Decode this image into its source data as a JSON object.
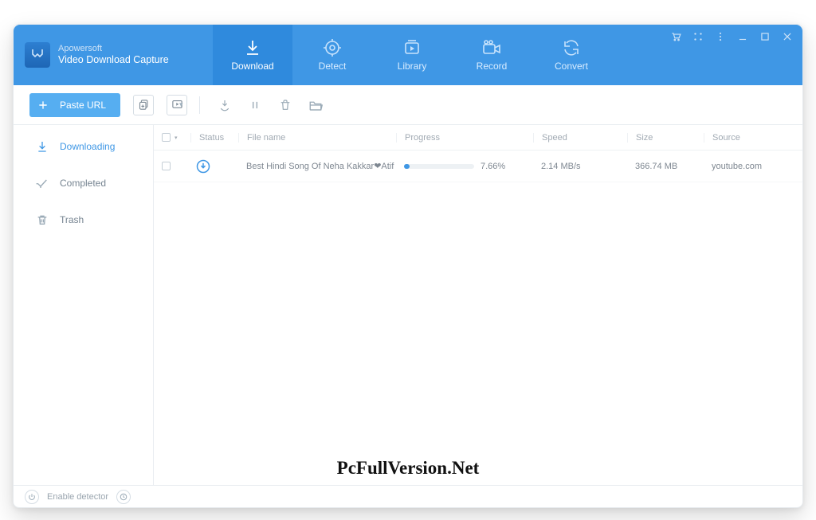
{
  "brand": {
    "line1": "Apowersoft",
    "line2": "Video Download Capture"
  },
  "nav": {
    "download": "Download",
    "detect": "Detect",
    "library": "Library",
    "record": "Record",
    "convert": "Convert"
  },
  "toolbar": {
    "paste_url": "Paste URL"
  },
  "sidebar": {
    "downloading": "Downloading",
    "completed": "Completed",
    "trash": "Trash"
  },
  "columns": {
    "status": "Status",
    "name": "File name",
    "progress": "Progress",
    "speed": "Speed",
    "size": "Size",
    "source": "Source"
  },
  "rows": [
    {
      "name": "Best Hindi Song Of Neha Kakkar❤Atif ...",
      "percent": "7.66%",
      "percent_value": 7.66,
      "speed": "2.14 MB/s",
      "size": "366.74 MB",
      "source": "youtube.com"
    }
  ],
  "statusbar": {
    "detector": "Enable detector"
  },
  "watermark": "PcFullVersion.Net"
}
